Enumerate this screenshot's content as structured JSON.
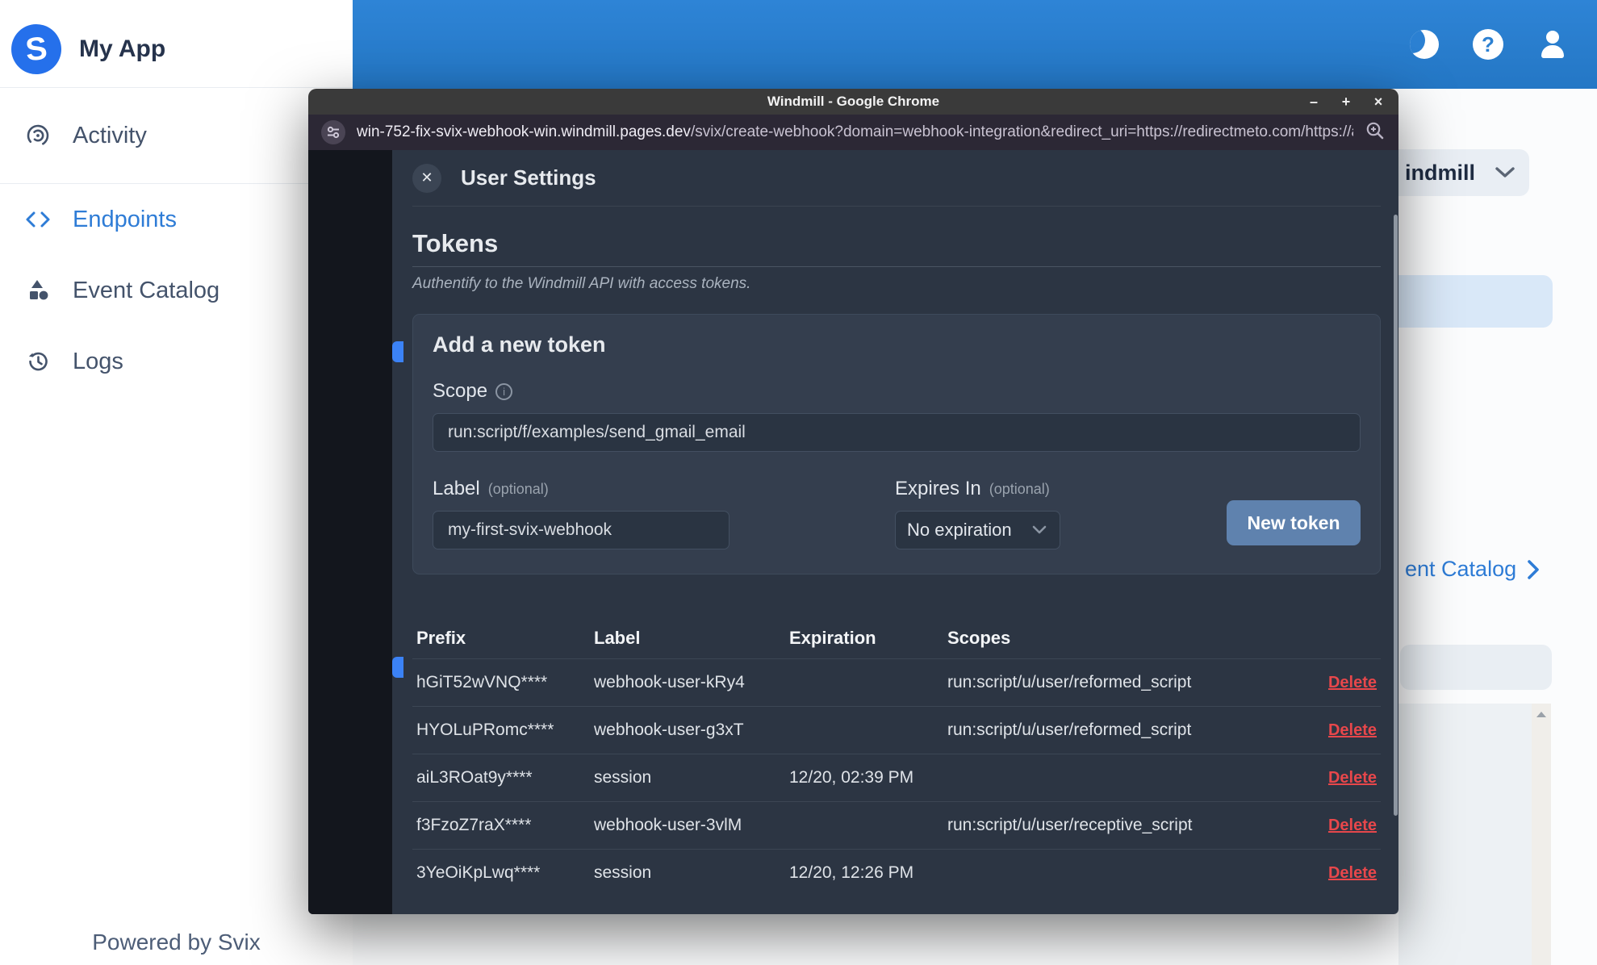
{
  "colors": {
    "header_blue": "#2b80d2",
    "accent_blue": "#2e7cd6",
    "logo_blue": "#2570eb",
    "button_blue": "#5f82ae",
    "delete_red": "#e8474b",
    "modal_bg": "#2c3543"
  },
  "sidebar": {
    "app_name": "My App",
    "logo_letter": "S",
    "items": [
      {
        "label": "Activity",
        "icon": "activity-target-icon",
        "active": false
      },
      {
        "label": "Endpoints",
        "icon": "code-brackets-icon",
        "active": true
      },
      {
        "label": "Event Catalog",
        "icon": "shapes-icon",
        "active": false
      },
      {
        "label": "Logs",
        "icon": "history-clock-icon",
        "active": false
      }
    ],
    "footer": "Powered by Svix"
  },
  "app_header": {
    "icons": [
      "moon-icon",
      "help-icon",
      "user-icon"
    ]
  },
  "background_page": {
    "workspace_dropdown": "indmill",
    "catalog_link": "ent Catalog"
  },
  "chrome": {
    "title": "Windmill - Google Chrome",
    "controls": [
      "–",
      "+",
      "×"
    ],
    "url_domain": "win-752-fix-svix-webhook-win.windmill.pages.dev",
    "url_path": "/svix/create-webhook?domain=webhook-integration&redirect_uri=https://redirectmeto.com/https://app....",
    "url_icons": [
      "site-settings-icon",
      "zoom-in-icon"
    ]
  },
  "modal": {
    "title": "User Settings",
    "section_title": "Tokens",
    "section_subtitle": "Authentify to the Windmill API with access tokens.",
    "form": {
      "title": "Add a new token",
      "scope_label": "Scope",
      "scope_value": "run:script/f/examples/send_gmail_email",
      "label_label": "Label",
      "optional": "(optional)",
      "label_value": "my-first-svix-webhook",
      "expires_label": "Expires In",
      "expires_value": "No expiration",
      "submit_label": "New token"
    },
    "table": {
      "headers": [
        "Prefix",
        "Label",
        "Expiration",
        "Scopes"
      ],
      "delete_label": "Delete",
      "rows": [
        {
          "prefix": "hGiT52wVNQ****",
          "label": "webhook-user-kRy4",
          "expiration": "",
          "scopes": "run:script/u/user/reformed_script"
        },
        {
          "prefix": "HYOLuPRomc****",
          "label": "webhook-user-g3xT",
          "expiration": "",
          "scopes": "run:script/u/user/reformed_script"
        },
        {
          "prefix": "aiL3ROat9y****",
          "label": "session",
          "expiration": "12/20, 02:39 PM",
          "scopes": ""
        },
        {
          "prefix": "f3FzoZ7raX****",
          "label": "webhook-user-3vlM",
          "expiration": "",
          "scopes": "run:script/u/user/receptive_script"
        },
        {
          "prefix": "3YeOiKpLwq****",
          "label": "session",
          "expiration": "12/20, 12:26 PM",
          "scopes": ""
        }
      ]
    }
  }
}
